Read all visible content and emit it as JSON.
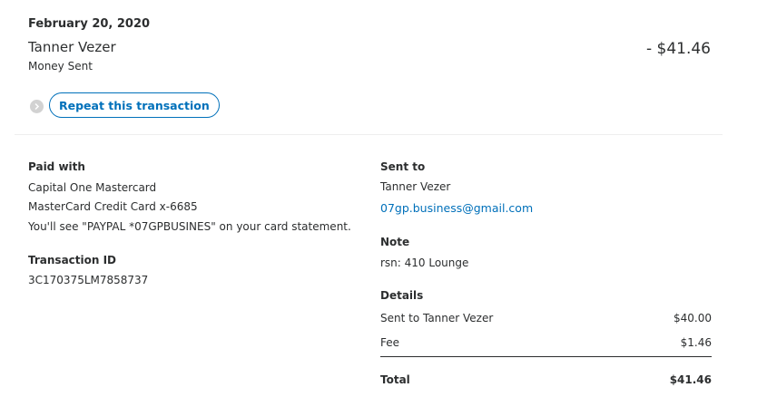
{
  "transaction": {
    "date": "February 20, 2020",
    "recipient": "Tanner Vezer",
    "type": "Money Sent",
    "amount": "- $41.46",
    "repeat_label": "Repeat this transaction"
  },
  "paid_with": {
    "heading": "Paid with",
    "card_name": "Capital One Mastercard",
    "card_number": "MasterCard Credit Card x-6685",
    "statement_note": "You'll see \"PAYPAL *07GPBUSINES\" on your card statement."
  },
  "transaction_id": {
    "heading": "Transaction ID",
    "value": "3C170375LM7858737"
  },
  "sent_to": {
    "heading": "Sent to",
    "name": "Tanner Vezer",
    "email": "07gp.business@gmail.com"
  },
  "note": {
    "heading": "Note",
    "text": "rsn: 410 Lounge"
  },
  "details": {
    "heading": "Details",
    "rows": [
      {
        "label": "Sent to Tanner Vezer",
        "value": "$40.00"
      },
      {
        "label": "Fee",
        "value": "$1.46"
      }
    ],
    "total_label": "Total",
    "total_value": "$41.46"
  },
  "colors": {
    "link": "#0070ba",
    "text": "#2c2e2f"
  }
}
